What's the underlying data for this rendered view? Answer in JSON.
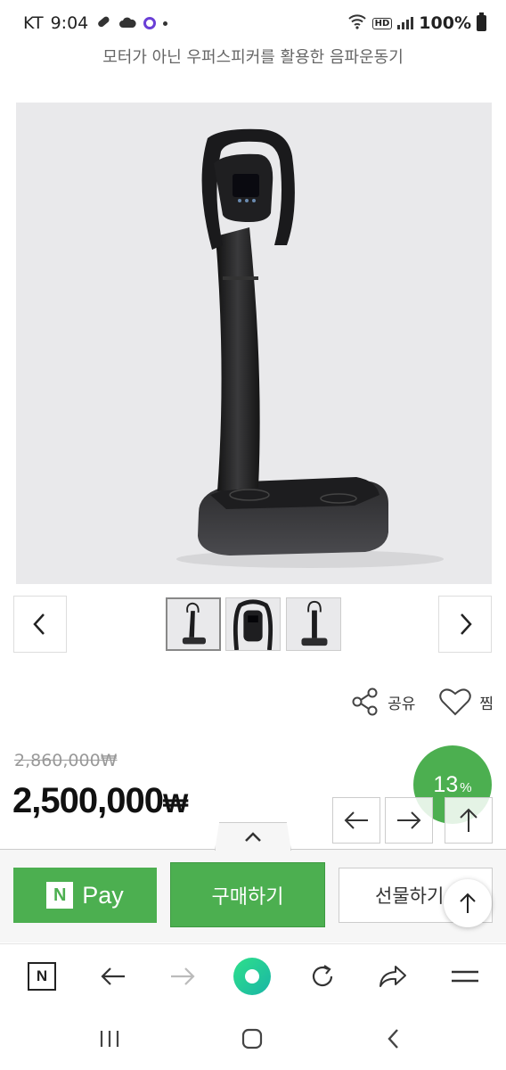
{
  "status_bar": {
    "carrier": "KT",
    "time": "9:04",
    "battery": "100%",
    "hd_label": "HD"
  },
  "subtitle": "모터가 아닌 우퍼스피커를 활용한 음파운동기",
  "actions": {
    "share_label": "공유",
    "wish_label": "찜"
  },
  "pricing": {
    "original_price": "2,860,000₩",
    "price": "2,500,000",
    "currency": "₩",
    "discount_value": "13",
    "discount_unit": "%"
  },
  "purchase": {
    "npay_logo": "N",
    "npay_label": "Pay",
    "buy_label": "구매하기",
    "gift_label": "선물하기"
  },
  "toolbar": {
    "home_logo": "N"
  },
  "colors": {
    "accent_green": "#4caf50",
    "text_dark": "#111111",
    "text_muted": "#999999"
  }
}
